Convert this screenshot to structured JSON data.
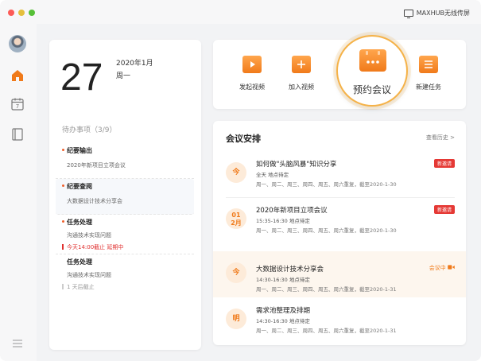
{
  "titlebar": {
    "cast_label": "MAXHUB无线传屏"
  },
  "colors": {
    "accent": "#f07a1a",
    "alert": "#e53935"
  },
  "sidebar": {
    "icons": [
      "avatar",
      "home-icon",
      "calendar-icon",
      "notebook-icon",
      "menu-icon"
    ],
    "calendar_day": "7"
  },
  "date_card": {
    "day": "27",
    "year_month": "2020年1月",
    "weekday": "周一"
  },
  "todo": {
    "header": "待办事项（3/9）",
    "items": [
      {
        "title": "纪要输出",
        "sub": "2020年新项目立项会议",
        "note": ""
      },
      {
        "title": "纪要查阅",
        "sub": "大数据设计技术分享会",
        "note": ""
      },
      {
        "title": "任务处理",
        "sub": "沟通技术实现问题",
        "note": "今天14:00截止  延期中"
      },
      {
        "title": "任务处理",
        "sub": "沟通技术实现问题",
        "note": "1 天后截止"
      }
    ]
  },
  "actions": {
    "start_video": "发起视频",
    "join_video": "加入视频",
    "book_meeting": "预约会议",
    "new_task": "新建任务"
  },
  "meetings": {
    "title": "会议安排",
    "history_link": "查看历史 >",
    "items": [
      {
        "badge": "今",
        "name": "如何做\"头脑风暴\"知识分享",
        "time": "全天    地点待定",
        "repeat": "周一、周二、周三、周四、周五、周六重复，截至2020-1-30",
        "tag": "新邀请"
      },
      {
        "badge_top": "01",
        "badge_bottom": "2月",
        "name": "2020年新项目立项会议",
        "time": "15:35-16:30    地点待定",
        "repeat": "周一、周二、周三、周四、周五、周六重复，截至2020-1-30",
        "tag": "新邀请"
      },
      {
        "badge": "今",
        "name": "大数据设计技术分享会",
        "time": "14:30-16:30    地点待定",
        "repeat": "周一、周二、周三、周四、周五、周六重复，截至2020-1-31",
        "status": "会议中"
      },
      {
        "badge": "明",
        "name": "需求池整理及排期",
        "time": "14:30-16:30    地点待定",
        "repeat": "周一、周二、周三、周四、周五、周六重复，截至2020-1-31"
      }
    ]
  }
}
